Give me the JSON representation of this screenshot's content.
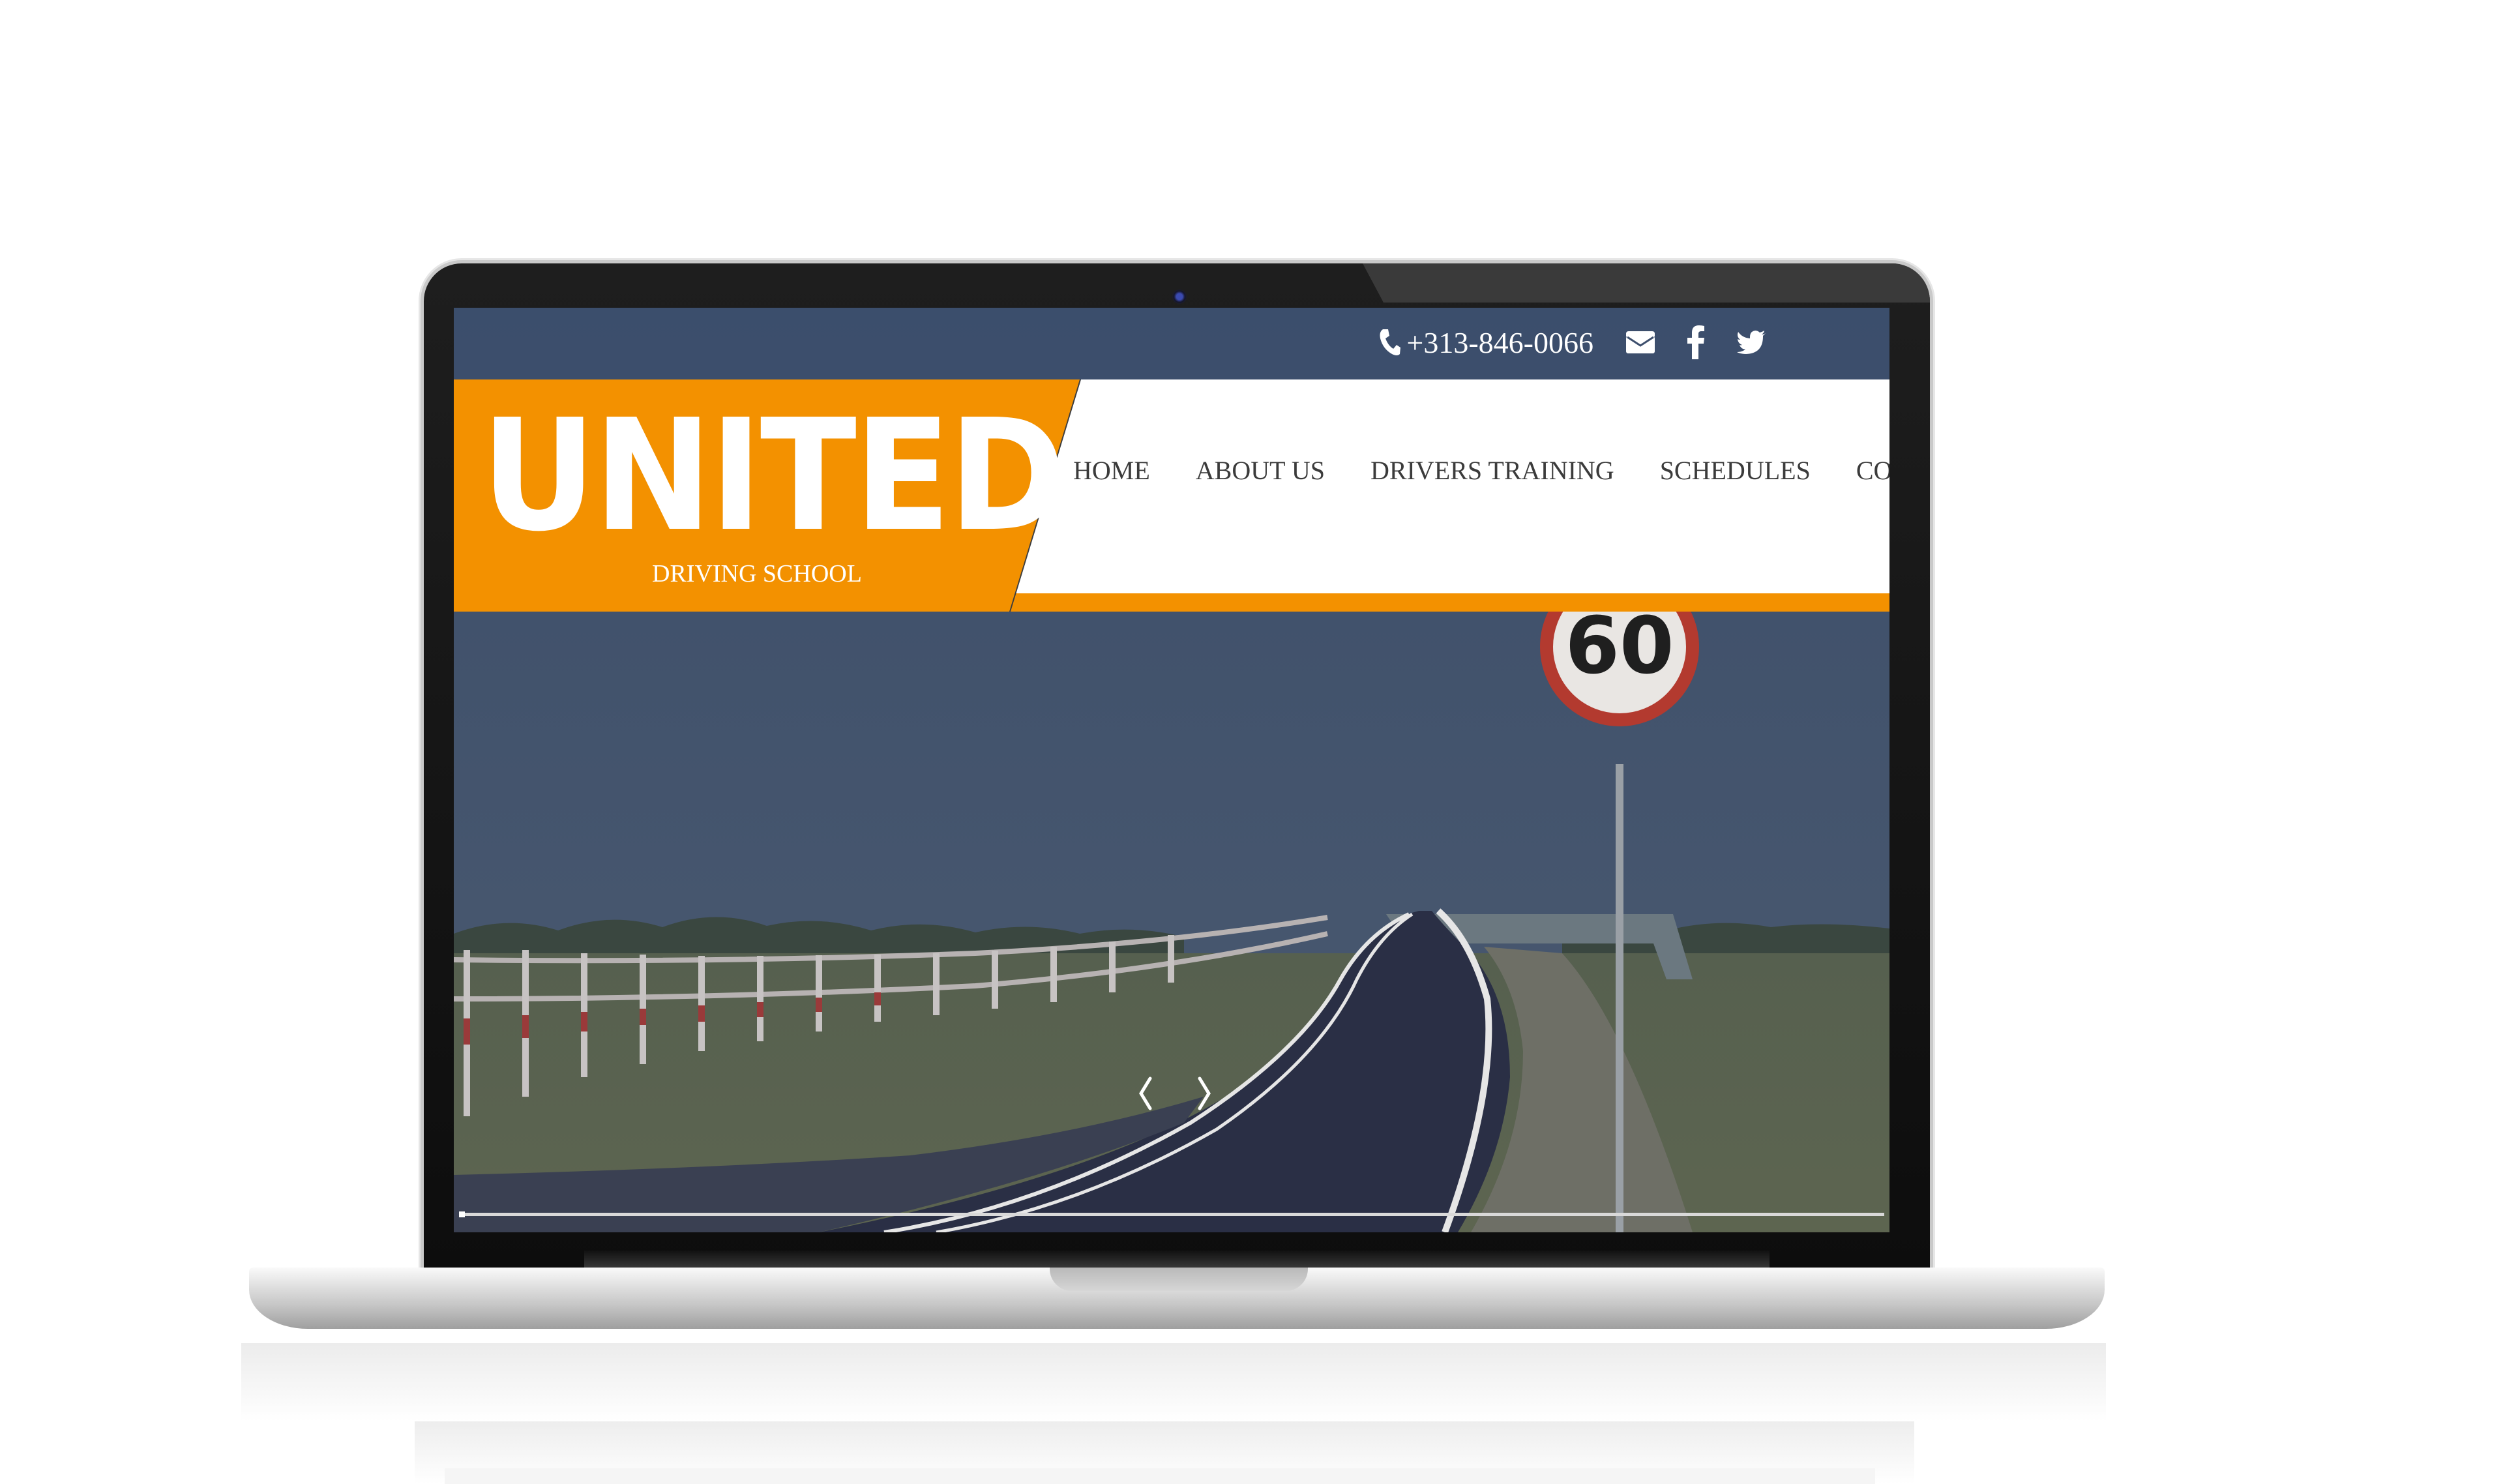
{
  "site": {
    "logo_text": "UNITED",
    "logo_subtitle": "DRIVING SCHOOL"
  },
  "topbar": {
    "phone": "+313-846-0066",
    "icons": [
      "phone-icon",
      "envelope-icon",
      "facebook-icon",
      "twitter-icon"
    ]
  },
  "nav": {
    "items": [
      {
        "label": "HOME"
      },
      {
        "label": "ABOUT US"
      },
      {
        "label": "DRIVERS TRAINING"
      },
      {
        "label": "SCHEDULES"
      },
      {
        "label": "CONTACT US"
      }
    ]
  },
  "slider": {
    "prev_icon": "chevron-left-icon",
    "next_icon": "chevron-right-icon",
    "progress_fraction": 0.004,
    "speed_sign": "60"
  },
  "colors": {
    "accent": "#f39100",
    "topbar": "#3c4e6c",
    "nav_text": "#3b3b3b"
  }
}
